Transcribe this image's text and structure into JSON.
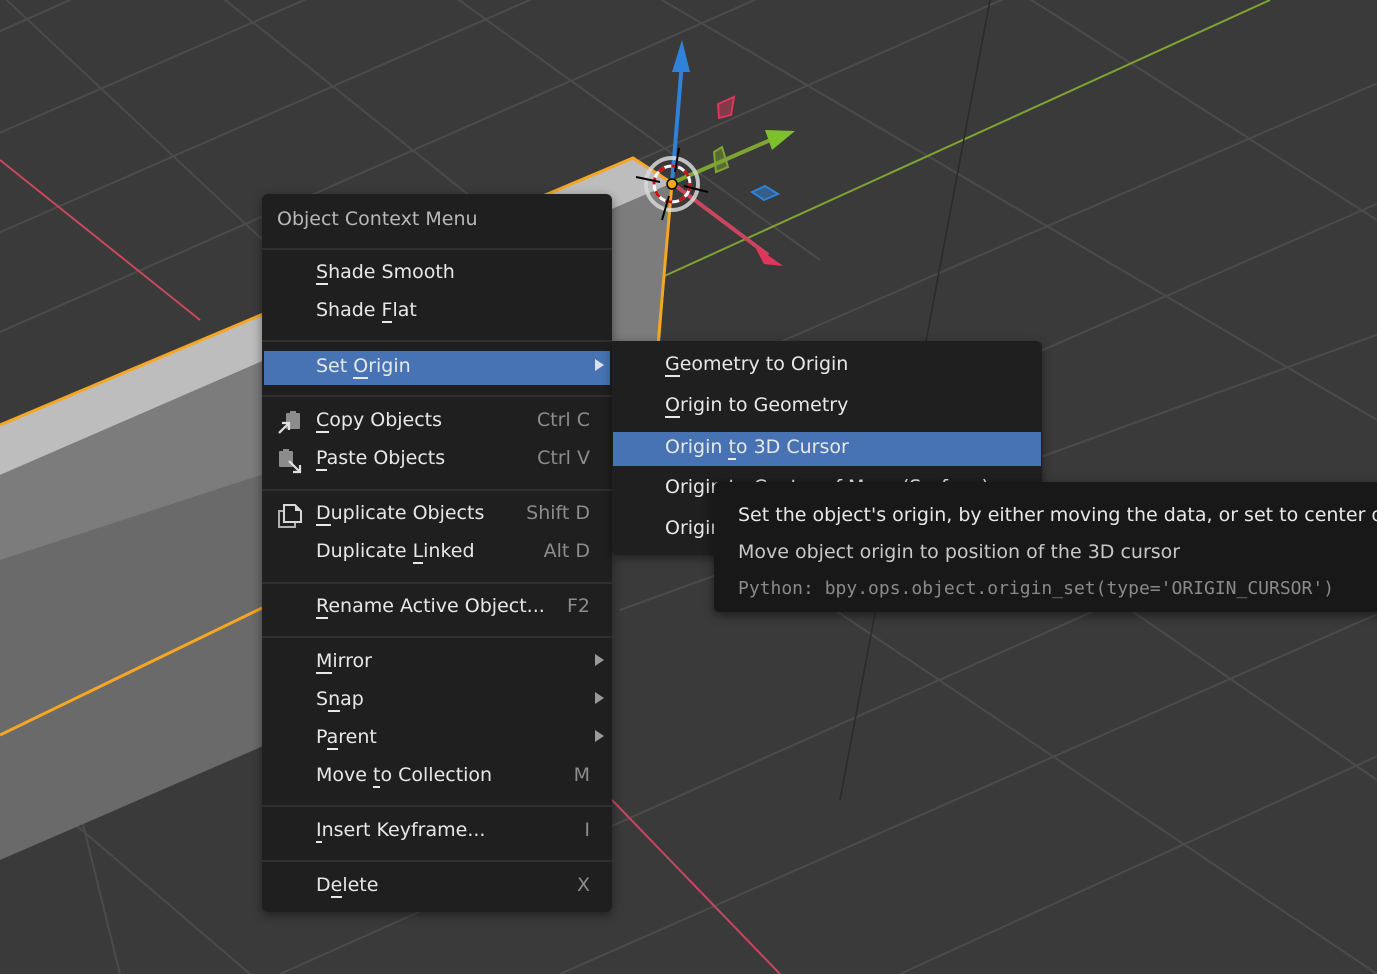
{
  "app": "Blender 3D Viewport",
  "colors": {
    "viewport_bg": "#3a3a3a",
    "grid": "#4a4a4a",
    "x_axis": "#c9465f",
    "y_axis": "#7ea531",
    "z_axis": "#2f82d8",
    "selection_outline": "#f5a623",
    "menu_bg": "#1f1f1f",
    "highlight": "#4772b3",
    "tooltip_bg": "#181818"
  },
  "context_menu": {
    "title": "Object Context Menu",
    "items": [
      {
        "pre": "",
        "ul": "S",
        "post": "hade Smooth",
        "shortcut": "",
        "icon": ""
      },
      {
        "pre": "Shade ",
        "ul": "F",
        "post": "lat",
        "shortcut": "",
        "icon": ""
      },
      {
        "pre": "Set ",
        "ul": "O",
        "post": "rigin",
        "shortcut": "",
        "icon": "submenu-arrow",
        "active": true
      },
      {
        "pre": "",
        "ul": "C",
        "post": "opy Objects",
        "shortcut": "Ctrl C",
        "icon": "copy-objects-icon"
      },
      {
        "pre": "",
        "ul": "P",
        "post": "aste Objects",
        "shortcut": "Ctrl V",
        "icon": "paste-objects-icon"
      },
      {
        "pre": "",
        "ul": "D",
        "post": "uplicate Objects",
        "shortcut": "Shift D",
        "icon": "duplicate-icon"
      },
      {
        "pre": "Duplicate ",
        "ul": "L",
        "post": "inked",
        "shortcut": "Alt D",
        "icon": ""
      },
      {
        "pre": "",
        "ul": "R",
        "post": "ename Active Object...",
        "shortcut": "F2",
        "icon": ""
      },
      {
        "pre": "",
        "ul": "M",
        "post": "irror",
        "shortcut": "",
        "icon": "submenu-arrow"
      },
      {
        "pre": "S",
        "ul": "n",
        "post": "ap",
        "shortcut": "",
        "icon": "submenu-arrow"
      },
      {
        "pre": "P",
        "ul": "a",
        "post": "rent",
        "shortcut": "",
        "icon": "submenu-arrow"
      },
      {
        "pre": "Move ",
        "ul": "t",
        "post": "o Collection",
        "shortcut": "M",
        "icon": ""
      },
      {
        "pre": "",
        "ul": "I",
        "post": "nsert Keyframe...",
        "shortcut": "I",
        "icon": ""
      },
      {
        "pre": "D",
        "ul": "e",
        "post": "lete",
        "shortcut": "X",
        "icon": ""
      }
    ]
  },
  "set_origin_submenu": {
    "items": [
      {
        "pre": "",
        "ul": "G",
        "post": "eometry to Origin"
      },
      {
        "pre": "",
        "ul": "O",
        "post": "rigin to Geometry"
      },
      {
        "pre": "Origin ",
        "ul": "t",
        "post": "o 3D Cursor",
        "active": true
      },
      {
        "pre": "Origin to ",
        "ul": "C",
        "post": "enter of Mass (Surface)"
      },
      {
        "pre": "Origin to Center of Mass (Volume)",
        "ul": "",
        "post": ""
      }
    ]
  },
  "tooltip": {
    "description": "Set the object's origin, by either moving the data, or set to center of",
    "operation": "Move object origin to position of the 3D cursor",
    "python": "Python: bpy.ops.object.origin_set(type='ORIGIN_CURSOR')"
  }
}
